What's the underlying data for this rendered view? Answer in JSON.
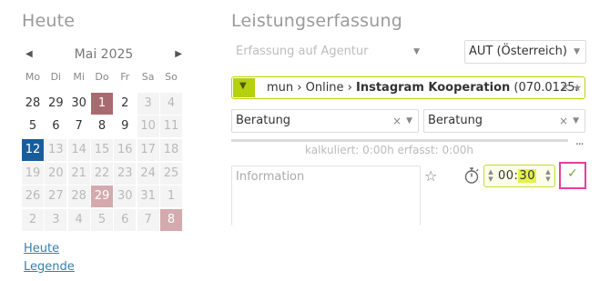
{
  "left": {
    "title": "Heute",
    "month_label": "Mai 2025",
    "weekdays": [
      "Mo",
      "Di",
      "Mi",
      "Do",
      "Fr",
      "Sa",
      "So"
    ],
    "days": [
      {
        "d": "28",
        "s": "normal"
      },
      {
        "d": "29",
        "s": "normal"
      },
      {
        "d": "30",
        "s": "normal"
      },
      {
        "d": "1",
        "s": "holiday"
      },
      {
        "d": "2",
        "s": "normal"
      },
      {
        "d": "3",
        "s": "muted"
      },
      {
        "d": "4",
        "s": "muted"
      },
      {
        "d": "5",
        "s": "normal"
      },
      {
        "d": "6",
        "s": "normal"
      },
      {
        "d": "7",
        "s": "normal"
      },
      {
        "d": "8",
        "s": "normal"
      },
      {
        "d": "9",
        "s": "normal"
      },
      {
        "d": "10",
        "s": "muted"
      },
      {
        "d": "11",
        "s": "muted"
      },
      {
        "d": "12",
        "s": "today"
      },
      {
        "d": "13",
        "s": "muted"
      },
      {
        "d": "14",
        "s": "muted"
      },
      {
        "d": "15",
        "s": "muted"
      },
      {
        "d": "16",
        "s": "muted"
      },
      {
        "d": "17",
        "s": "muted"
      },
      {
        "d": "18",
        "s": "muted"
      },
      {
        "d": "19",
        "s": "muted"
      },
      {
        "d": "20",
        "s": "muted"
      },
      {
        "d": "21",
        "s": "muted"
      },
      {
        "d": "22",
        "s": "muted"
      },
      {
        "d": "23",
        "s": "muted"
      },
      {
        "d": "24",
        "s": "muted"
      },
      {
        "d": "25",
        "s": "muted"
      },
      {
        "d": "26",
        "s": "muted"
      },
      {
        "d": "27",
        "s": "muted"
      },
      {
        "d": "28",
        "s": "muted"
      },
      {
        "d": "29",
        "s": "holiday-light"
      },
      {
        "d": "30",
        "s": "muted"
      },
      {
        "d": "31",
        "s": "muted"
      },
      {
        "d": "1",
        "s": "muted"
      },
      {
        "d": "2",
        "s": "muted"
      },
      {
        "d": "3",
        "s": "muted"
      },
      {
        "d": "4",
        "s": "muted"
      },
      {
        "d": "5",
        "s": "muted"
      },
      {
        "d": "6",
        "s": "muted"
      },
      {
        "d": "7",
        "s": "muted"
      },
      {
        "d": "8",
        "s": "holiday-light"
      }
    ],
    "links": {
      "today": "Heute",
      "legend": "Legende"
    }
  },
  "right": {
    "title": "Leistungserfassung",
    "agency_select": "Erfassung auf Agentur",
    "country_select": "AUT (Österreich)",
    "project_path_prefix": "mun › Online › ",
    "project_name": "Instagram Kooperation",
    "project_code": " (070.0125.",
    "service_1": "Beratung",
    "service_2": "Beratung",
    "summary": "kalkuliert: 0:00h  erfasst: 0:00h",
    "more": "...",
    "info_placeholder": "Information",
    "time_hours": "00:",
    "time_minutes": "30"
  },
  "icons": {
    "prev": "chevron-left-icon",
    "next": "chevron-right-icon",
    "caret": "caret-down-icon",
    "clear": "clear-icon",
    "star": "star-icon",
    "stopwatch": "stopwatch-icon",
    "check": "check-icon"
  },
  "colors": {
    "today": "#1a5c9a",
    "holiday": "#a96a6f",
    "holiday_light": "#d4aaae",
    "accent_green": "#b5cf11",
    "confirm_border": "#e93d9a"
  }
}
